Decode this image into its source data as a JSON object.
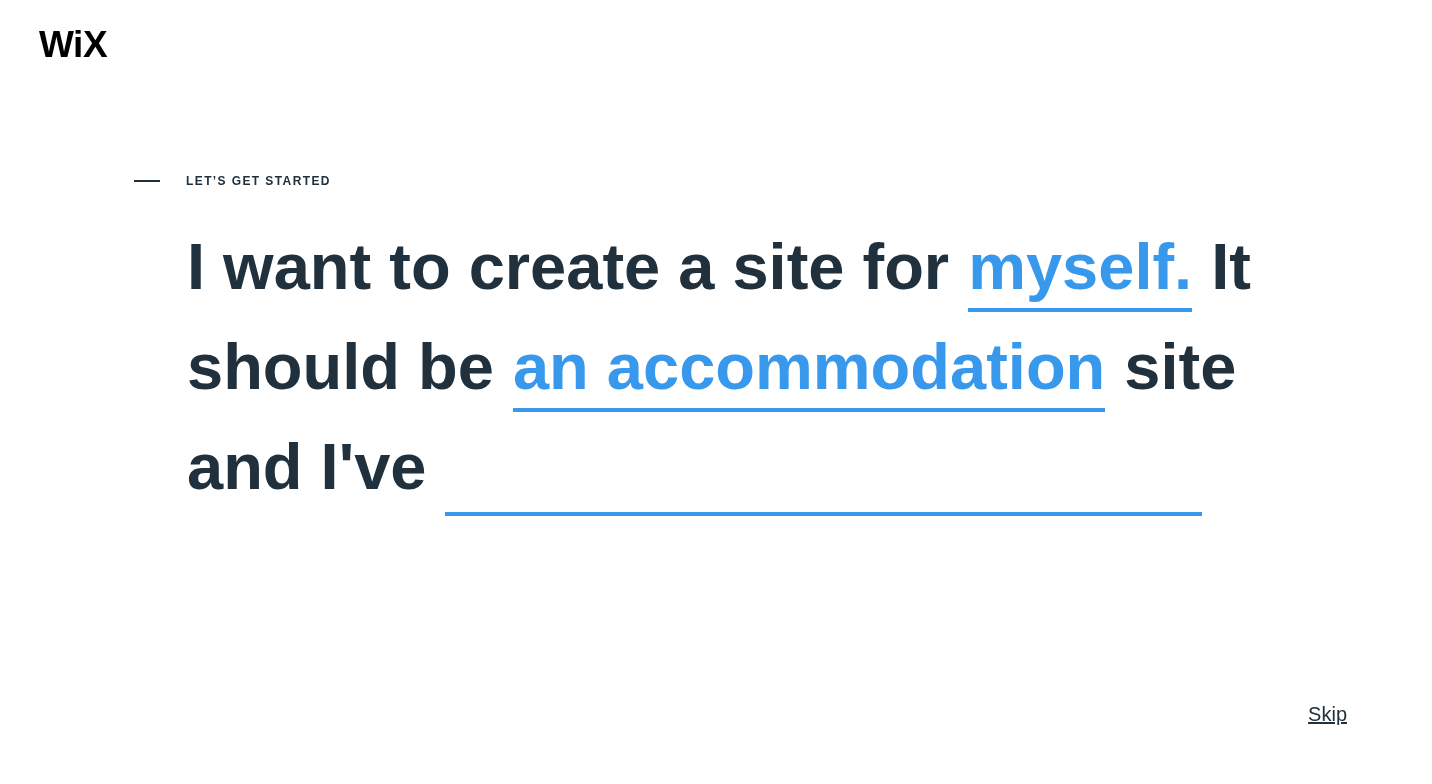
{
  "logo": {
    "text": "WiX"
  },
  "eyebrow": {
    "text": "LET’S GET STARTED"
  },
  "sentence": {
    "lines": [
      [
        {
          "kind": "text",
          "text": "I want to create a site for"
        },
        {
          "kind": "choice",
          "text": "myself."
        },
        {
          "kind": "text",
          "text": "It"
        }
      ],
      [
        {
          "kind": "text",
          "text": "should be"
        },
        {
          "kind": "choice",
          "text": "an accommodation"
        },
        {
          "kind": "text",
          "text": "site"
        }
      ],
      [
        {
          "kind": "text",
          "text": "and I've"
        },
        {
          "kind": "blank"
        }
      ]
    ]
  },
  "skip": {
    "text": "Skip"
  }
}
